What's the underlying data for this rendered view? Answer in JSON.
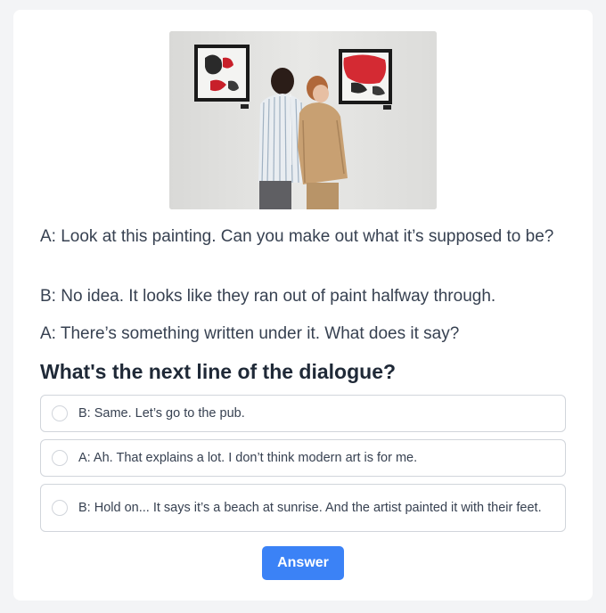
{
  "image": {
    "alt": "Two people looking at abstract paintings in a gallery"
  },
  "dialogue": [
    "A: Look at this painting. Can you make out what it’s supposed to be?",
    "B: No idea. It looks like they ran out of paint halfway through.",
    "A: There’s something written under it. What does it say?"
  ],
  "question": "What's the next line of the dialogue?",
  "options": [
    "B: Same. Let’s go to the pub.",
    "A: Ah. That explains a lot. I don’t think modern art is for me.",
    "B: Hold on... It says it’s a beach at sunrise. And the artist painted it with their feet."
  ],
  "answer_button": "Answer",
  "colors": {
    "accent": "#3b82f6",
    "text": "#374151",
    "heading": "#1f2937",
    "page_bg": "#f3f4f6"
  }
}
